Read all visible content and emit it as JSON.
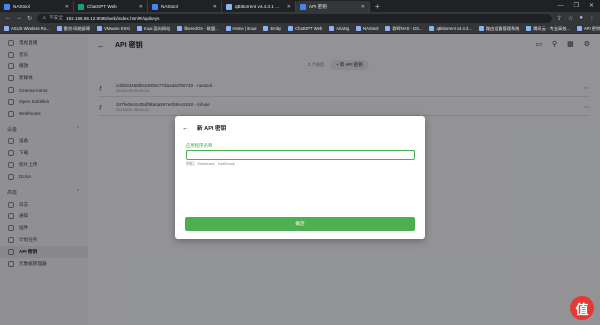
{
  "browser": {
    "tabs": [
      {
        "title": "NAStool",
        "color": "#4285f4",
        "active": false
      },
      {
        "title": "ChatGPT Web",
        "color": "#10a37f",
        "active": false
      },
      {
        "title": "NAStool",
        "color": "#4285f4",
        "active": false
      },
      {
        "title": "qBittorrent v4.4.3.1 Web UI",
        "color": "#8ab4f8",
        "active": false
      },
      {
        "title": "API 密钥",
        "color": "#4285f4",
        "active": true
      }
    ],
    "security_label": "不安全",
    "url": "192.168.66.12:8096/web/index.html#!/apikeys",
    "bookmarks": [
      "ASUS Wireless Ro...",
      "雷池-网络屏障",
      "VMware ESXi",
      "Kuai 面向网站",
      "filteredOS - 联盟...",
      "Home | iKuai",
      "Emby",
      "ChatGPT Web",
      "AriaNg",
      "NAStool",
      "群晖NAS - DS...",
      "qBittorrent v4.4.3...",
      "路由设备管理系统",
      "腾讯云 - 专业高效...",
      "API 密钥 - DSGM..."
    ]
  },
  "sidebar": {
    "items_top": [
      {
        "label": "电视直播"
      },
      {
        "label": "音乐"
      },
      {
        "label": "播放"
      },
      {
        "label": "新媒体"
      },
      {
        "label": "Cinema Intros"
      },
      {
        "label": "Open Subtitles"
      },
      {
        "label": "Webhooks"
      }
    ],
    "section_devices": "设备",
    "items_devices": [
      {
        "label": "设备"
      },
      {
        "label": "下载"
      },
      {
        "label": "照片上传"
      },
      {
        "label": "DLNA"
      }
    ],
    "section_advanced": "高级",
    "items_advanced": [
      {
        "label": "日志",
        "active": false
      },
      {
        "label": "通知",
        "active": false
      },
      {
        "label": "插件",
        "active": false
      },
      {
        "label": "计划任务",
        "active": false
      },
      {
        "label": "API 密钥",
        "active": true
      },
      {
        "label": "元数据管理器",
        "active": false
      }
    ]
  },
  "page": {
    "title": "API 密钥",
    "key_count": "2 个项目",
    "new_key_label": "新 API 密钥",
    "keys": [
      {
        "key": "cd2b03458b643009c77da4a5cf60740 - nastool",
        "date": "2023/1/30 20:54:24"
      },
      {
        "key": "347fe06c0c05df9fa0a567e0b9ce2818 - Infuse",
        "date": "2023/3/21 20:04:14"
      }
    ]
  },
  "dialog": {
    "title": "新 API 密钥",
    "field_label": "应用程序名称",
    "field_value": "",
    "field_hint": "例如：Sickbeard、NzbDrone",
    "confirm_label": "确定"
  },
  "watermark": "值"
}
